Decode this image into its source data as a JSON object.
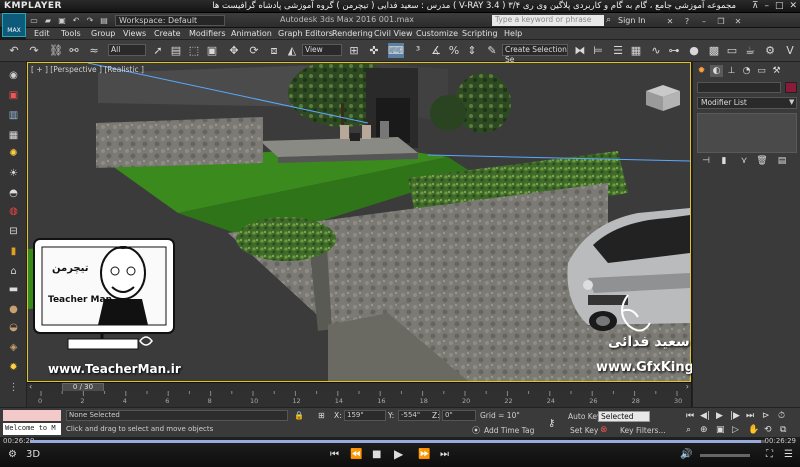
{
  "player": {
    "name": "KMPLAYER",
    "title": "مجموعه آموزشی جامع ، گام به گام و کاربردی پلاگین وی ری ۳/۴  ( V-RAY 3.4 )  مدرس : سعید فدایی ( تیچرمن ) گروه آموزشی پادشاه گرافیست ها",
    "current_time": "00:26:20",
    "total_time": "00:26:29",
    "progress": 0.995
  },
  "max_title": {
    "logo": "MAX",
    "workspace": "Workspace: Default",
    "app_title": "Autodesk 3ds Max 2016    001.max",
    "search_placeholder": "Type a keyword or phrase",
    "sign_in": "Sign In"
  },
  "menu": [
    "Edit",
    "Tools",
    "Group",
    "Views",
    "Create",
    "Modifiers",
    "Animation",
    "Graph Editors",
    "Rendering",
    "Civil View",
    "Customize",
    "Scripting",
    "Help"
  ],
  "toolbar": {
    "selection_filter": "All",
    "ref_coord": "View",
    "selection_set": "Create Selection Se"
  },
  "viewport": {
    "label": "[ + ] [Perspective ] [Realistic ]"
  },
  "command_panel": {
    "modifier_list": "Modifier List"
  },
  "time_slider": {
    "position": "0 / 30",
    "ticks": [
      "0",
      "2",
      "4",
      "6",
      "8",
      "10",
      "12",
      "14",
      "16",
      "18",
      "20",
      "22",
      "24",
      "26",
      "28",
      "30"
    ]
  },
  "status": {
    "welcome": "Welcome to M",
    "selection": "None Selected",
    "prompt": "Click and drag to select and move objects",
    "x_label": "X:",
    "x_value": "159\"",
    "y_label": "Y:",
    "y_value": "-554\"",
    "z_label": "Z:",
    "z_value": "0\"",
    "grid": "Grid = 10\"",
    "add_time_tag": "Add Time Tag",
    "auto_key": "Auto Key",
    "key_mode": "Selected",
    "set_key": "Set Key",
    "key_filters": "Key Filters..."
  },
  "watermarks": {
    "teacher_url": "www.TeacherMan.ir",
    "gfx_url": "www.GfxKing.ir",
    "teacher_name": "سعید فدائی",
    "logo_text_fa": "تیچرمن",
    "logo_text_en": "Teacher Man"
  }
}
